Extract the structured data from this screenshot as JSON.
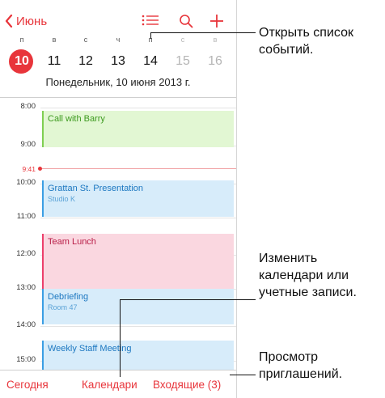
{
  "nav": {
    "back_label": "Июнь",
    "list_icon": "list-icon",
    "search_icon": "search-icon",
    "add_icon": "plus-icon"
  },
  "week": {
    "weekdays": [
      "п",
      "в",
      "с",
      "ч",
      "п",
      "с",
      "в"
    ],
    "dates": [
      "10",
      "11",
      "12",
      "13",
      "14",
      "15",
      "16"
    ],
    "selected_index": 0
  },
  "full_date": "Понедельник, 10 июня 2013 г.",
  "timeline": {
    "hours": [
      "8:00",
      "9:00",
      "10:00",
      "11:00",
      "12:00",
      "13:00",
      "14:00",
      "15:00"
    ],
    "now_label": "9:41"
  },
  "events": [
    {
      "title": "Call with Barry",
      "subtitle": "",
      "color": "green"
    },
    {
      "title": "Grattan St. Presentation",
      "subtitle": "Studio K",
      "color": "blue"
    },
    {
      "title": "Team Lunch",
      "subtitle": "",
      "color": "pink"
    },
    {
      "title": "Debriefing",
      "subtitle": "Room 47",
      "color": "blue"
    },
    {
      "title": "Weekly Staff Meeting",
      "subtitle": "",
      "color": "blue"
    }
  ],
  "toolbar": {
    "today": "Сегодня",
    "calendars": "Календари",
    "inbox": "Входящие (3)"
  },
  "callouts": {
    "list": [
      "Открыть список",
      "событий."
    ],
    "calendars": [
      "Изменить",
      "календари или",
      "учетные записи."
    ],
    "inbox": [
      "Просмотр",
      "приглашений."
    ]
  },
  "colors": {
    "accent": "#e8353b",
    "green_event": "#e2f7d3",
    "blue_event": "#d7ecfa",
    "pink_event": "#fad7e0"
  }
}
